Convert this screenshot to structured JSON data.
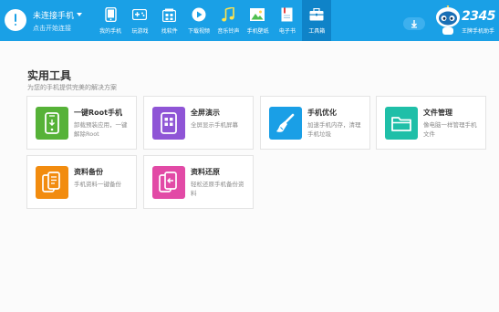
{
  "colors": {
    "header_bg": "#1aa0e6",
    "active_tab_bg": "#0f83c8",
    "page_bg": "#fbfbfb",
    "card_border": "#e4e4e4",
    "root_green": "#56b238",
    "screen_purple": "#8f55d6",
    "optimize_blue": "#1a9fe6",
    "files_teal": "#1fbfa8",
    "backup_orange": "#f28c0f",
    "restore_pink": "#e24aa6"
  },
  "device": {
    "status": "未连接手机",
    "hint": "点击开始连接",
    "icon": "exclamation-circle-icon"
  },
  "nav": {
    "items": [
      {
        "label": "我的手机",
        "icon": "phone-icon"
      },
      {
        "label": "玩游戏",
        "icon": "gamepad-icon"
      },
      {
        "label": "找软件",
        "icon": "apps-icon"
      },
      {
        "label": "下载视频",
        "icon": "play-icon"
      },
      {
        "label": "音乐铃声",
        "icon": "music-note-icon"
      },
      {
        "label": "手机壁纸",
        "icon": "wallpaper-icon"
      },
      {
        "label": "电子书",
        "icon": "ebook-icon"
      },
      {
        "label": "工具箱",
        "icon": "toolbox-icon"
      }
    ]
  },
  "brand": {
    "number": "2345",
    "slogan": "王牌手机助手",
    "icon": "robot-mascot-icon"
  },
  "page": {
    "title": "实用工具",
    "subtitle": "为您的手机提供完美的解决方案"
  },
  "tools": [
    {
      "title": "一键Root手机",
      "desc": "卸载预装应用，一键解除Root",
      "icon": "root-phone-icon"
    },
    {
      "title": "全屏演示",
      "desc": "全屏显示手机屏幕",
      "icon": "fullscreen-apps-icon"
    },
    {
      "title": "手机优化",
      "desc": "加速手机内存，清理手机垃圾",
      "icon": "brush-icon"
    },
    {
      "title": "文件管理",
      "desc": "像电脑一样管理手机文件",
      "icon": "folder-icon"
    },
    {
      "title": "资料备份",
      "desc": "手机资料一键备份",
      "icon": "backup-icon"
    },
    {
      "title": "资料还原",
      "desc": "轻松还原手机备份资料",
      "icon": "restore-icon"
    }
  ]
}
